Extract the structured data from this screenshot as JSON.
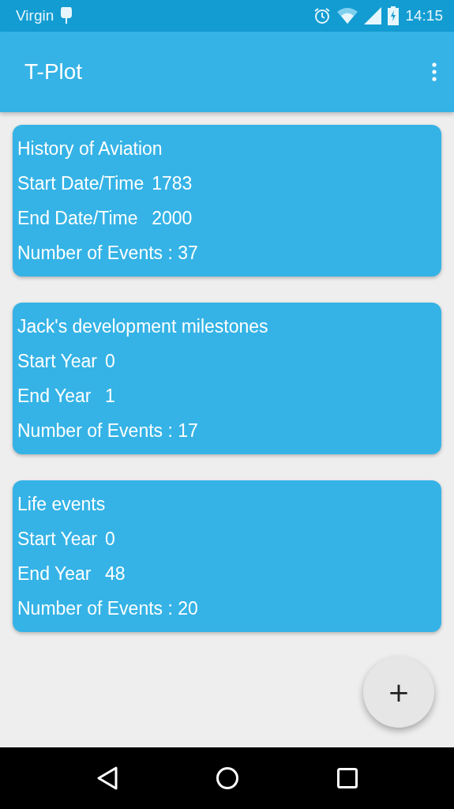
{
  "status_bar": {
    "carrier": "Virgin",
    "time": "14:15"
  },
  "app_bar": {
    "title": "T-Plot"
  },
  "timelines": [
    {
      "title": "History of Aviation",
      "fields": [
        {
          "label": "Start Date/Time",
          "value": "1783"
        },
        {
          "label": "End Date/Time",
          "value": "2000"
        }
      ],
      "events": "Number of Events : 37"
    },
    {
      "title": "Jack's development milestones",
      "fields": [
        {
          "label": "Start Year",
          "value": "0"
        },
        {
          "label": "End Year",
          "value": "1"
        }
      ],
      "events": "Number of Events : 17"
    },
    {
      "title": "Life events",
      "fields": [
        {
          "label": "Start Year",
          "value": "0"
        },
        {
          "label": "End Year",
          "value": "48"
        }
      ],
      "events": "Number of Events : 20"
    }
  ],
  "fab": {
    "label": "+"
  }
}
